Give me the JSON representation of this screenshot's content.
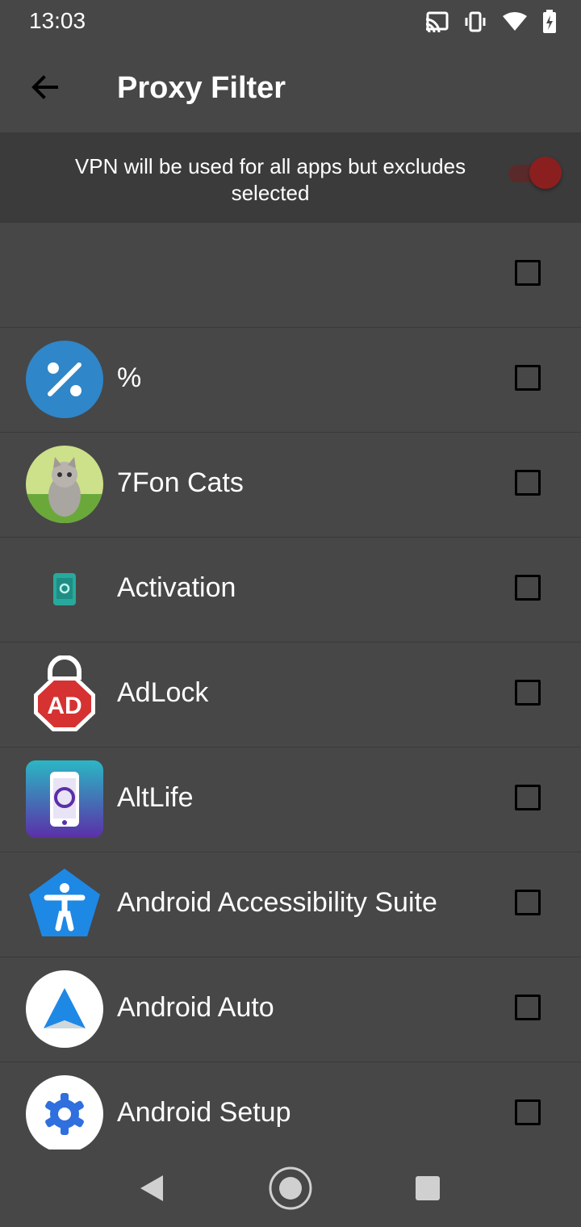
{
  "status": {
    "time": "13:03",
    "icons": [
      "cast-icon",
      "vibrate-icon",
      "wifi-icon",
      "battery-charging-icon"
    ]
  },
  "appbar": {
    "title": "Proxy Filter",
    "back_icon": "arrow-left-icon"
  },
  "banner": {
    "text": "VPN will be used for all apps but excludes selected",
    "toggle_on": true,
    "toggle_color": "#8b1f1f"
  },
  "apps": [
    {
      "name": "",
      "icon": "none",
      "checked": false
    },
    {
      "name": "%",
      "icon": "percent-app-icon",
      "checked": false
    },
    {
      "name": "7Fon Cats",
      "icon": "cat-photo-icon",
      "checked": false
    },
    {
      "name": "Activation",
      "icon": "phone-gear-icon",
      "checked": false
    },
    {
      "name": "AdLock",
      "icon": "adlock-icon",
      "checked": false
    },
    {
      "name": "AltLife",
      "icon": "altlife-icon",
      "checked": false
    },
    {
      "name": "Android Accessibility Suite",
      "icon": "accessibility-icon",
      "checked": false
    },
    {
      "name": "Android Auto",
      "icon": "android-auto-icon",
      "checked": false
    },
    {
      "name": "Android Setup",
      "icon": "gear-icon",
      "checked": false
    }
  ],
  "navbar": {
    "icons": [
      "nav-back-icon",
      "nav-home-icon",
      "nav-recents-icon"
    ]
  }
}
